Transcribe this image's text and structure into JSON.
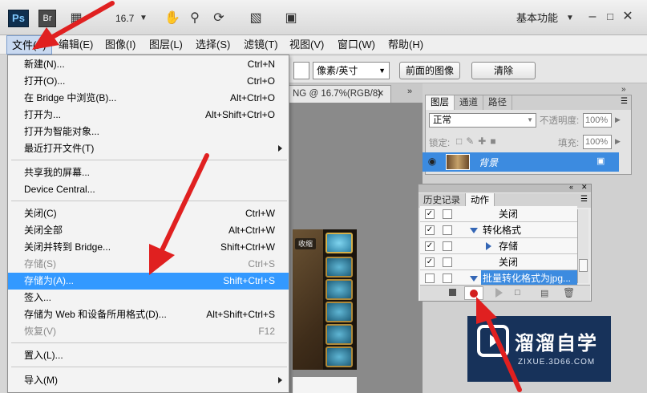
{
  "appbar": {
    "ps_logo": "Ps",
    "br_logo": "Br",
    "zoom": "16.7",
    "workspace": "基本功能"
  },
  "menubar": {
    "items": [
      "文件(F)",
      "编辑(E)",
      "图像(I)",
      "图层(L)",
      "选择(S)",
      "滤镜(T)",
      "视图(V)",
      "窗口(W)",
      "帮助(H)"
    ]
  },
  "options": {
    "unit": "像素/英寸",
    "front_image": "前面的图像",
    "clear": "清除"
  },
  "document_tab": "NG @ 16.7%(RGB/8)",
  "layers_panel": {
    "tabs": [
      "图层",
      "通道",
      "路径"
    ],
    "blend_mode": "正常",
    "opacity_label": "不透明度:",
    "opacity_value": "100%",
    "lock_label": "锁定:",
    "fill_label": "填充:",
    "fill_value": "100%",
    "layer_name": "背景"
  },
  "actions_panel": {
    "tabs": [
      "历史记录",
      "动作"
    ],
    "rows": [
      "关闭",
      "转化格式",
      "存储",
      "关闭",
      "批量转化格式为jpg..."
    ]
  },
  "file_menu": {
    "group1": [
      {
        "label": "新建(N)...",
        "shortcut": "Ctrl+N"
      },
      {
        "label": "打开(O)...",
        "shortcut": "Ctrl+O"
      },
      {
        "label": "在 Bridge 中浏览(B)...",
        "shortcut": "Alt+Ctrl+O"
      },
      {
        "label": "打开为...",
        "shortcut": "Alt+Shift+Ctrl+O"
      },
      {
        "label": "打开为智能对象...",
        "shortcut": ""
      },
      {
        "label": "最近打开文件(T)",
        "shortcut": ""
      }
    ],
    "group2": [
      {
        "label": "共享我的屏幕..."
      },
      {
        "label": "Device Central..."
      }
    ],
    "group3": [
      {
        "label": "关闭(C)",
        "shortcut": "Ctrl+W"
      },
      {
        "label": "关闭全部",
        "shortcut": "Alt+Ctrl+W"
      },
      {
        "label": "关闭并转到 Bridge...",
        "shortcut": "Shift+Ctrl+W"
      },
      {
        "label": "存储(S)",
        "shortcut": "Ctrl+S"
      },
      {
        "label": "存储为(A)...",
        "shortcut": "Shift+Ctrl+S"
      },
      {
        "label": "签入...",
        "shortcut": ""
      },
      {
        "label": "存储为 Web 和设备所用格式(D)...",
        "shortcut": "Alt+Shift+Ctrl+S"
      },
      {
        "label": "恢复(V)",
        "shortcut": "F12"
      }
    ],
    "group4": [
      {
        "label": "置入(L)..."
      }
    ],
    "group5": [
      {
        "label": "导入(M)"
      }
    ]
  },
  "canvas_badge": "收缩",
  "watermark": {
    "title": "溜溜自学",
    "url": "ZIXUE.3D66.COM"
  },
  "colors": {
    "highlight": "#3399ff",
    "arrow": "#e02020",
    "panel_select": "#3c8be0"
  }
}
